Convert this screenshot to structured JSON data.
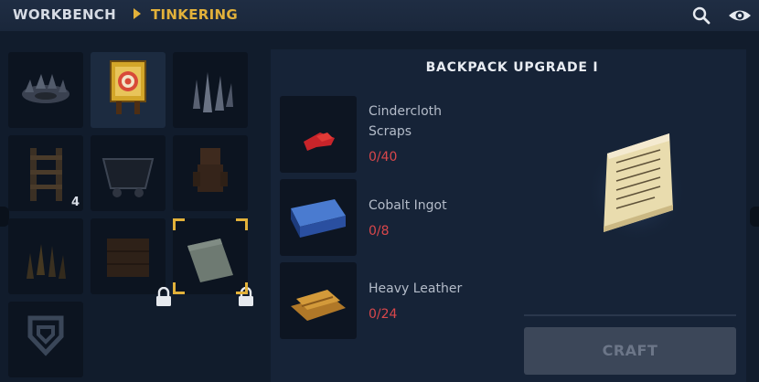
{
  "breadcrumb": {
    "root": "WORKBENCH",
    "current": "TINKERING"
  },
  "icons": {
    "search": "search-icon",
    "visibility": "eye-icon"
  },
  "grid": {
    "slots": [
      {
        "name": "spiked-trap",
        "selected": false,
        "locked": false
      },
      {
        "name": "target-dummy",
        "selected": true,
        "locked": false
      },
      {
        "name": "spike-cluster",
        "selected": false,
        "locked": false
      },
      {
        "name": "ladder",
        "selected": false,
        "locked": false,
        "count": "4"
      },
      {
        "name": "mine-cart",
        "selected": false,
        "locked": false
      },
      {
        "name": "wooden-idol",
        "selected": false,
        "locked": false
      },
      {
        "name": "stakes",
        "selected": false,
        "locked": false
      },
      {
        "name": "crate",
        "selected": false,
        "locked": true
      },
      {
        "name": "backpack-upgrade",
        "selected": false,
        "locked": true,
        "highlighted": true
      },
      {
        "name": "emblem",
        "selected": false,
        "locked": false
      }
    ]
  },
  "recipe": {
    "title": "BACKPACK UPGRADE I",
    "ingredients": [
      {
        "name": "Cindercloth Scraps",
        "qty": "0/40",
        "icon": "red-cloth-icon"
      },
      {
        "name": "Cobalt Ingot",
        "qty": "0/8",
        "icon": "blue-ingot-icon"
      },
      {
        "name": "Heavy Leather",
        "qty": "0/24",
        "icon": "leather-icon"
      }
    ],
    "preview_icon": "scroll-icon",
    "craft_label": "CRAFT"
  },
  "colors": {
    "accent": "#e2b13a",
    "missing": "#d9474b",
    "disabled_button": "#3c4759"
  }
}
